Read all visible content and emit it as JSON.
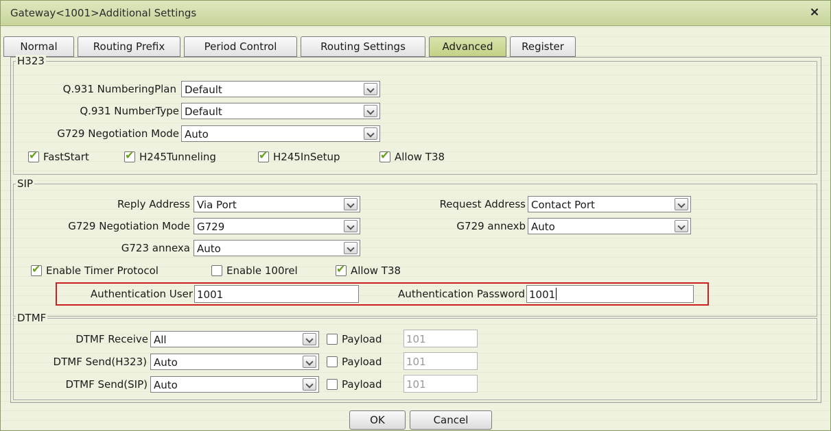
{
  "window": {
    "title": "Gateway<1001>Additional Settings",
    "close_glyph": "×"
  },
  "tabs": [
    "Normal",
    "Routing Prefix",
    "Period Control",
    "Routing Settings",
    "Advanced",
    "Register"
  ],
  "active_tab": "Advanced",
  "h323": {
    "legend": "H323",
    "numbering_plan_label": "Q.931 NumberingPlan",
    "numbering_plan_value": "Default",
    "number_type_label": "Q.931 NumberType",
    "number_type_value": "Default",
    "g729_mode_label": "G729 Negotiation Mode",
    "g729_mode_value": "Auto",
    "faststart_label": "FastStart",
    "faststart_checked": true,
    "h245tunneling_label": "H245Tunneling",
    "h245tunneling_checked": true,
    "h245insetup_label": "H245InSetup",
    "h245insetup_checked": true,
    "allow_t38_label": "Allow T38",
    "allow_t38_checked": true
  },
  "sip": {
    "legend": "SIP",
    "reply_address_label": "Reply Address",
    "reply_address_value": "Via Port",
    "request_address_label": "Request Address",
    "request_address_value": "Contact Port",
    "g729_mode_label": "G729 Negotiation Mode",
    "g729_mode_value": "G729",
    "g729_annexb_label": "G729 annexb",
    "g729_annexb_value": "Auto",
    "g723_annexa_label": "G723 annexa",
    "g723_annexa_value": "Auto",
    "timer_label": "Enable Timer Protocol",
    "timer_checked": true,
    "rel100_label": "Enable 100rel",
    "rel100_checked": false,
    "allow_t38_label": "Allow T38",
    "allow_t38_checked": true,
    "auth_user_label": "Authentication User",
    "auth_user_value": "1001",
    "auth_password_label": "Authentication Password",
    "auth_password_value": "1001"
  },
  "dtmf": {
    "legend": "DTMF",
    "receive_label": "DTMF Receive",
    "receive_value": "All",
    "send_h323_label": "DTMF Send(H323)",
    "send_h323_value": "Auto",
    "send_sip_label": "DTMF Send(SIP)",
    "send_sip_value": "Auto",
    "payload_label": "Payload",
    "payload_value": "101"
  },
  "buttons": {
    "ok": "OK",
    "cancel": "Cancel"
  }
}
